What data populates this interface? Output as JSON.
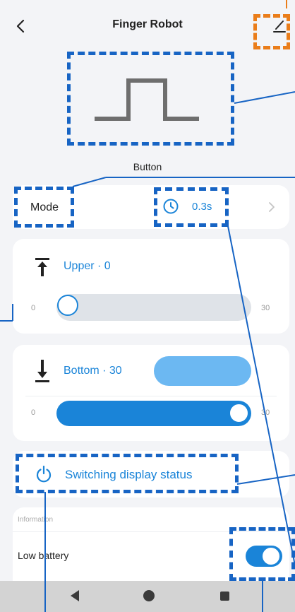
{
  "header": {
    "title": "Finger Robot"
  },
  "mode_caption": "Button",
  "mode_row": {
    "label": "Mode",
    "duration": "0.3s"
  },
  "upper": {
    "text": "Upper · 0",
    "min": "0",
    "max": "30",
    "value": 0
  },
  "bottom": {
    "text": "Bottom · 30",
    "min": "0",
    "max": "30",
    "value": 30
  },
  "switch_display": {
    "label": "Switching display status"
  },
  "information": {
    "header": "Information",
    "battery_label": "Low battery",
    "battery_alert_on": true
  },
  "colors": {
    "accent": "#1a84d8",
    "annotation_blue": "#1764c4",
    "annotation_orange": "#ea7d1a"
  },
  "icons": [
    "back-icon",
    "edit-icon",
    "clock-icon",
    "chevron-right-icon",
    "upper-limit-icon",
    "bottom-limit-icon",
    "power-icon",
    "nav-back-icon",
    "nav-home-icon",
    "nav-recent-icon"
  ]
}
